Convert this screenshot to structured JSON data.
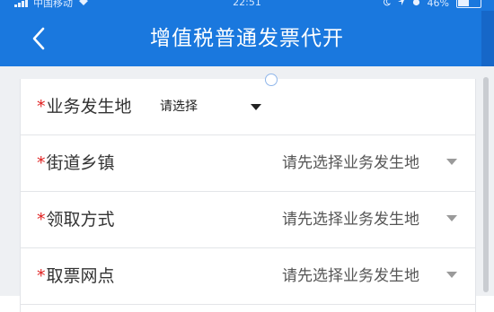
{
  "status_bar": {
    "carrier": "中国移动",
    "time": "22:51",
    "battery": "46%",
    "battery_level": 0.46
  },
  "nav": {
    "title": "增值税普通发票代开"
  },
  "form": {
    "rows": [
      {
        "required_mark": "*",
        "label": "业务发生地",
        "value": "请选择"
      },
      {
        "required_mark": "*",
        "label": "街道乡镇",
        "value": "请先选择业务发生地"
      },
      {
        "required_mark": "*",
        "label": "领取方式",
        "value": "请先选择业务发生地"
      },
      {
        "required_mark": "*",
        "label": "取票网点",
        "value": "请先选择业务发生地"
      }
    ]
  },
  "colors": {
    "brand": "#1a78de",
    "required": "#e02020"
  }
}
